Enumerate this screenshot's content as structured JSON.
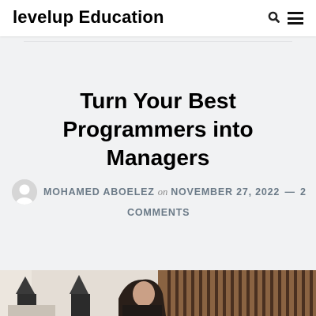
{
  "header": {
    "site_title": "levelup Education",
    "search_icon": "search-icon",
    "menu_icon": "hamburger-menu-icon"
  },
  "post": {
    "title_lines": [
      "Turn Your Best",
      "Programmers into",
      "Managers"
    ],
    "author": "MOHAMED ABOELEZ",
    "on_word": "on",
    "date": "NOVEMBER 27, 2022",
    "separator": "—",
    "comments_count": "2",
    "comments_word": "COMMENTS"
  },
  "colors": {
    "page_background": "#f1f2f3",
    "header_background": "#ffffff",
    "meta_text": "#6b7a87"
  }
}
